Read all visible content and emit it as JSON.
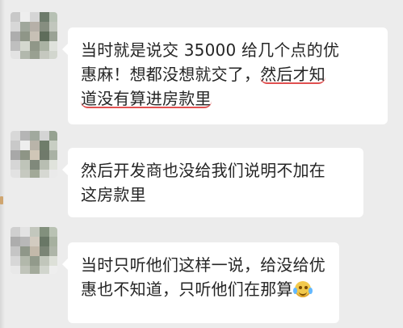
{
  "chat": {
    "messages": [
      {
        "line1": "当时就是说交 35000 给几个点的优",
        "line2_prefix": "惠麻！想都没想就交了，",
        "line2_highlight": "然后才知",
        "line3_highlight": "道没有算进房款里"
      },
      {
        "line1": "然后开发商也没给我们说明不加在",
        "line2": "这房款里"
      },
      {
        "line1": "当时只听他们这样一说，给没给优",
        "line2": "惠也不知道，只听他们在那算",
        "emoji": "laughing-crying-emoji"
      }
    ]
  },
  "colors": {
    "background": "#ececec",
    "bubble": "#ffffff",
    "text": "#252525",
    "underline": "#e05050"
  }
}
